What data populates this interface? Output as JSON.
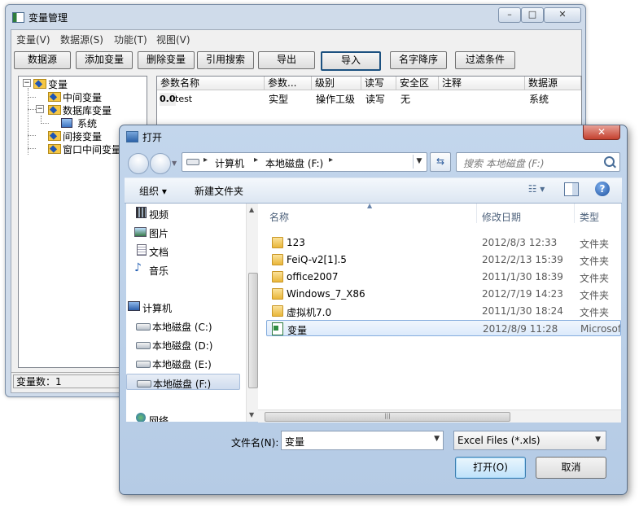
{
  "main_window": {
    "title": "变量管理",
    "menus": [
      "变量(V)",
      "数据源(S)",
      "功能(T)",
      "视图(V)"
    ],
    "toolbar": [
      "数据源",
      "添加变量",
      "删除变量",
      "引用搜索",
      "导出",
      "导入",
      "名字降序",
      "过滤条件"
    ],
    "tree": {
      "root": "变量",
      "children": [
        "中间变量",
        "数据库变量",
        "系统",
        "间接变量",
        "窗口中间变量"
      ]
    },
    "grid": {
      "headers": [
        "参数名称",
        "参数...",
        "级别",
        "读写",
        "安全区",
        "注释",
        "数据源"
      ],
      "row": {
        "name_prefix": "0.0",
        "name": "test",
        "type": "实型",
        "level": "操作工级",
        "rw": "读写",
        "zone": "无",
        "comment": "",
        "source": "系统"
      }
    },
    "status": "变量数：1",
    "caption_buttons": {
      "min": "–",
      "max": "□",
      "close": "✕"
    }
  },
  "dialog": {
    "title": "打开",
    "close_glyph": "✕",
    "breadcrumb": [
      "计算机",
      "本地磁盘 (F:)"
    ],
    "crumb_sep": "▸",
    "search_placeholder": "搜索 本地磁盘 (F:)",
    "organize_label": "组织 ▾",
    "new_folder_label": "新建文件夹",
    "views_glyph": "☷ ▾",
    "help_glyph": "?",
    "refresh_glyph": "⇆",
    "nav": {
      "libraries": [
        "视频",
        "图片",
        "文档",
        "音乐"
      ],
      "computer": "计算机",
      "drives": [
        "本地磁盘 (C:)",
        "本地磁盘 (D:)",
        "本地磁盘 (E:)",
        "本地磁盘 (F:)"
      ],
      "network": "网络"
    },
    "columns": [
      "名称",
      "修改日期",
      "类型"
    ],
    "files": [
      {
        "name": "123",
        "date": "2012/8/3 12:33",
        "type": "文件夹"
      },
      {
        "name": "FeiQ-v2[1].5",
        "date": "2012/2/13 15:39",
        "type": "文件夹"
      },
      {
        "name": "office2007",
        "date": "2011/1/30 18:39",
        "type": "文件夹"
      },
      {
        "name": "Windows_7_X86",
        "date": "2012/7/19 14:23",
        "type": "文件夹"
      },
      {
        "name": "虚拟机7.0",
        "date": "2011/1/30 18:24",
        "type": "文件夹"
      },
      {
        "name": "变量",
        "date": "2012/8/9 11:28",
        "type": "Microsoft"
      }
    ],
    "filename_label": "文件名(N):",
    "filename_value": "变量",
    "filetype_value": "Excel Files (*.xls)",
    "open_label": "打开(O)",
    "cancel_label": "取消"
  },
  "colors": {
    "title_bg": "#cfdbea",
    "selection": "#dceafb",
    "folder": "#f6c744"
  }
}
